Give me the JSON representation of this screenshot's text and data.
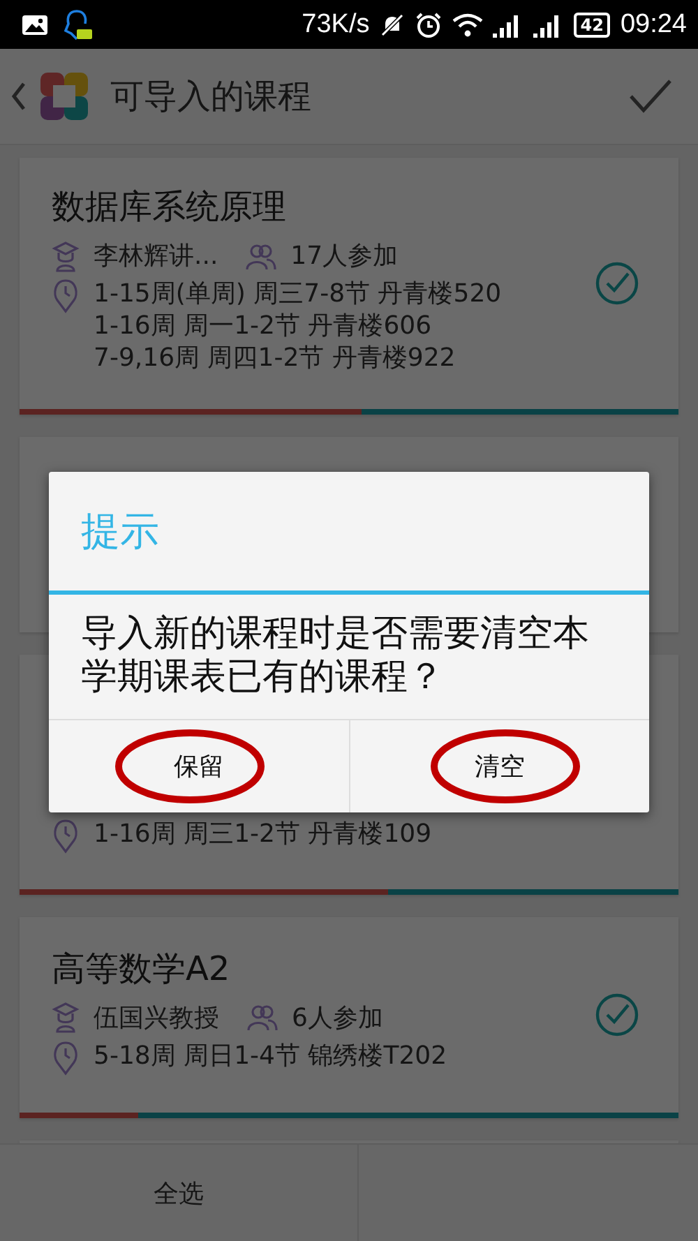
{
  "status_bar": {
    "speed": "73K/s",
    "battery": "42",
    "time": "09:24"
  },
  "app_bar": {
    "title": "可导入的课程"
  },
  "courses": [
    {
      "title": "数据库系统原理",
      "teacher": "李林辉讲...",
      "participants": "17人参加",
      "schedule": [
        "1-15周(单周) 周三7-8节 丹青楼520",
        "1-16周 周一1-2节 丹青楼606",
        "7-9,16周 周四1-2节 丹青楼922"
      ],
      "checked": true,
      "level": 0.52,
      "kind": "course"
    },
    {
      "kind": "covered"
    },
    {
      "schedule": [
        "1-16周 周三1-2节 丹青楼109"
      ],
      "level": 0.56,
      "kind": "course"
    },
    {
      "kind": "course",
      "title": "高等数学A2",
      "teacher": "伍国兴教授",
      "participants": "6人参加",
      "schedule": [
        "5-18周 周日1-4节 锦绣楼T202"
      ],
      "checked": true,
      "level": 0.18
    },
    {
      "kind": "covered"
    }
  ],
  "footer": {
    "buttons": [
      "全选"
    ]
  },
  "dialog": {
    "title": "提示",
    "message": "导入新的课程时是否需要清空本学期课表已有的课程？",
    "buttons": [
      {
        "label": "保留",
        "circled": true
      },
      {
        "label": "清空",
        "circled": true
      }
    ]
  }
}
